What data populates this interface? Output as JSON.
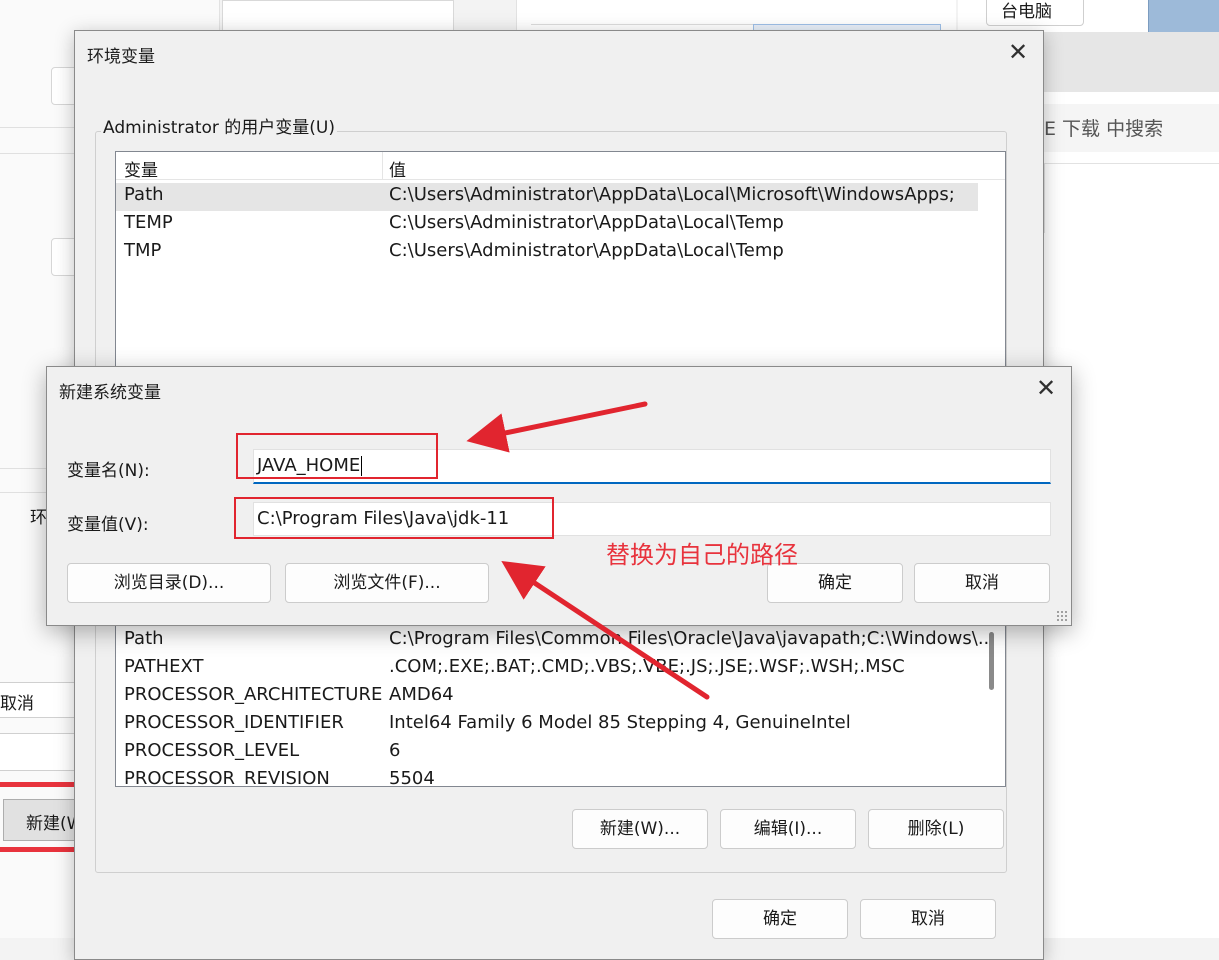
{
  "background": {
    "left_cancel_label": "取消",
    "left_new_label": "新建(W)",
    "left_partial_label": "环",
    "right_top_button_label": "台电脑",
    "right_search_text": "E 下载 中搜索"
  },
  "env_dialog": {
    "title": "环境变量",
    "user_group_label": "Administrator 的用户变量(U)",
    "columns": {
      "variable": "变量",
      "value": "值"
    },
    "user_vars": [
      {
        "name": "Path",
        "value": "C:\\Users\\Administrator\\AppData\\Local\\Microsoft\\WindowsApps;"
      },
      {
        "name": "TEMP",
        "value": "C:\\Users\\Administrator\\AppData\\Local\\Temp"
      },
      {
        "name": "TMP",
        "value": "C:\\Users\\Administrator\\AppData\\Local\\Temp"
      }
    ],
    "system_vars": [
      {
        "name": "Path",
        "value": "C:\\Program Files\\Common Files\\Oracle\\Java\\javapath;C:\\Windows\\..."
      },
      {
        "name": "PATHEXT",
        "value": ".COM;.EXE;.BAT;.CMD;.VBS;.VBE;.JS;.JSE;.WSF;.WSH;.MSC"
      },
      {
        "name": "PROCESSOR_ARCHITECTURE",
        "value": "AMD64"
      },
      {
        "name": "PROCESSOR_IDENTIFIER",
        "value": "Intel64 Family 6 Model 85 Stepping 4, GenuineIntel"
      },
      {
        "name": "PROCESSOR_LEVEL",
        "value": "6"
      },
      {
        "name": "PROCESSOR_REVISION",
        "value": "5504"
      }
    ],
    "system_buttons": {
      "new": "新建(W)...",
      "edit": "编辑(I)...",
      "delete": "删除(L)"
    },
    "ok": "确定",
    "cancel": "取消"
  },
  "new_var_dialog": {
    "title": "新建系统变量",
    "name_label": "变量名(N):",
    "name_value": "JAVA_HOME",
    "value_label": "变量值(V):",
    "value_value": "C:\\Program Files\\Java\\jdk-11",
    "browse_dir": "浏览目录(D)...",
    "browse_file": "浏览文件(F)...",
    "ok": "确定",
    "cancel": "取消"
  },
  "annotation": {
    "text": "替换为自己的路径",
    "color": "#e8333d"
  },
  "icons": {
    "close": "close-icon",
    "resize": "resize-grip-icon"
  }
}
